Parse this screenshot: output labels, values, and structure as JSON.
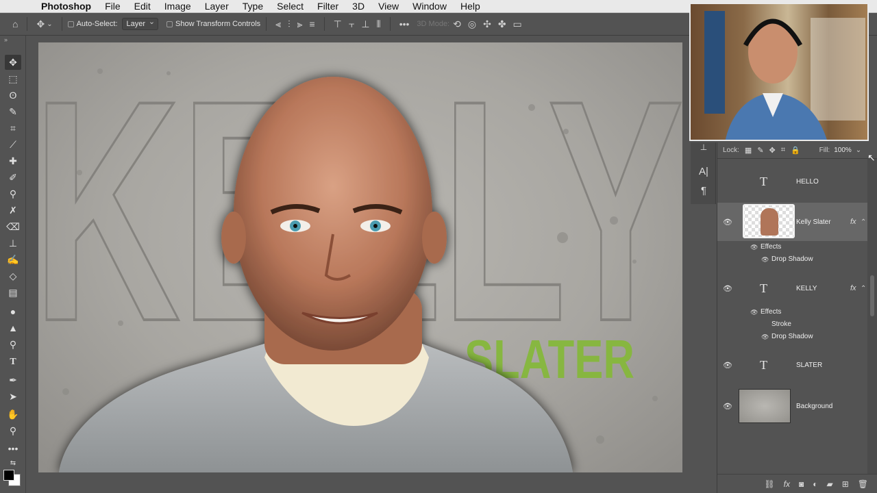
{
  "menubar": {
    "apple_icon": "apple-icon",
    "items": [
      "Photoshop",
      "File",
      "Edit",
      "Image",
      "Layer",
      "Type",
      "Select",
      "Filter",
      "3D",
      "View",
      "Window",
      "Help"
    ]
  },
  "options": {
    "auto_select_label": "Auto-Select:",
    "auto_select_value": "Layer",
    "show_transform_label": "Show Transform Controls",
    "mode_label": "3D Mode:"
  },
  "canvas": {
    "big_text": "KELLY",
    "slater_text": "SLATER",
    "slater_color": "#86b83c"
  },
  "layers_panel": {
    "lock_label": "Lock:",
    "fill_label": "Fill:",
    "fill_value": "100%",
    "layers": [
      {
        "name": "HELLO",
        "kind": "type",
        "visible": false
      },
      {
        "name": "Kelly Slater",
        "kind": "image",
        "visible": true,
        "fx": "fx",
        "effects_label": "Effects",
        "effects": [
          "Drop Shadow"
        ]
      },
      {
        "name": "KELLY",
        "kind": "type",
        "visible": true,
        "fx": "fx",
        "effects_label": "Effects",
        "effects": [
          "Stroke",
          "Drop Shadow"
        ]
      },
      {
        "name": "SLATER",
        "kind": "type",
        "visible": true
      },
      {
        "name": "Background",
        "kind": "image",
        "visible": true
      }
    ]
  }
}
